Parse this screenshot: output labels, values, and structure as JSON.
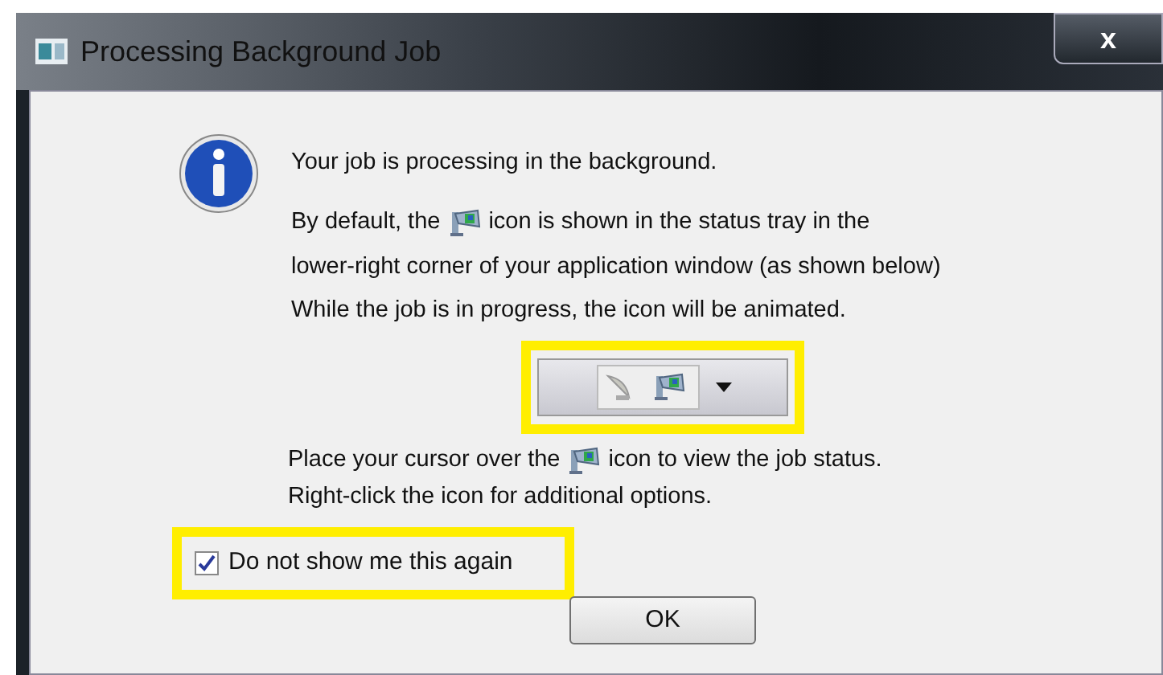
{
  "window": {
    "title": "Processing Background Job",
    "close": "x"
  },
  "message": {
    "heading": "Your job is processing in the background.",
    "line1_before": "By default, the",
    "line1_after": "icon is shown in the status tray in the",
    "line2": "lower-right corner of your application window (as shown below)",
    "line3": "While the job is in progress, the icon will be animated.",
    "hover_before": "Place your cursor over the",
    "hover_after": "icon to view the job status.",
    "right_click": "Right-click the icon for additional options."
  },
  "checkbox": {
    "label": "Do not show me this again",
    "checked": true
  },
  "buttons": [
    {
      "label": "OK"
    }
  ]
}
